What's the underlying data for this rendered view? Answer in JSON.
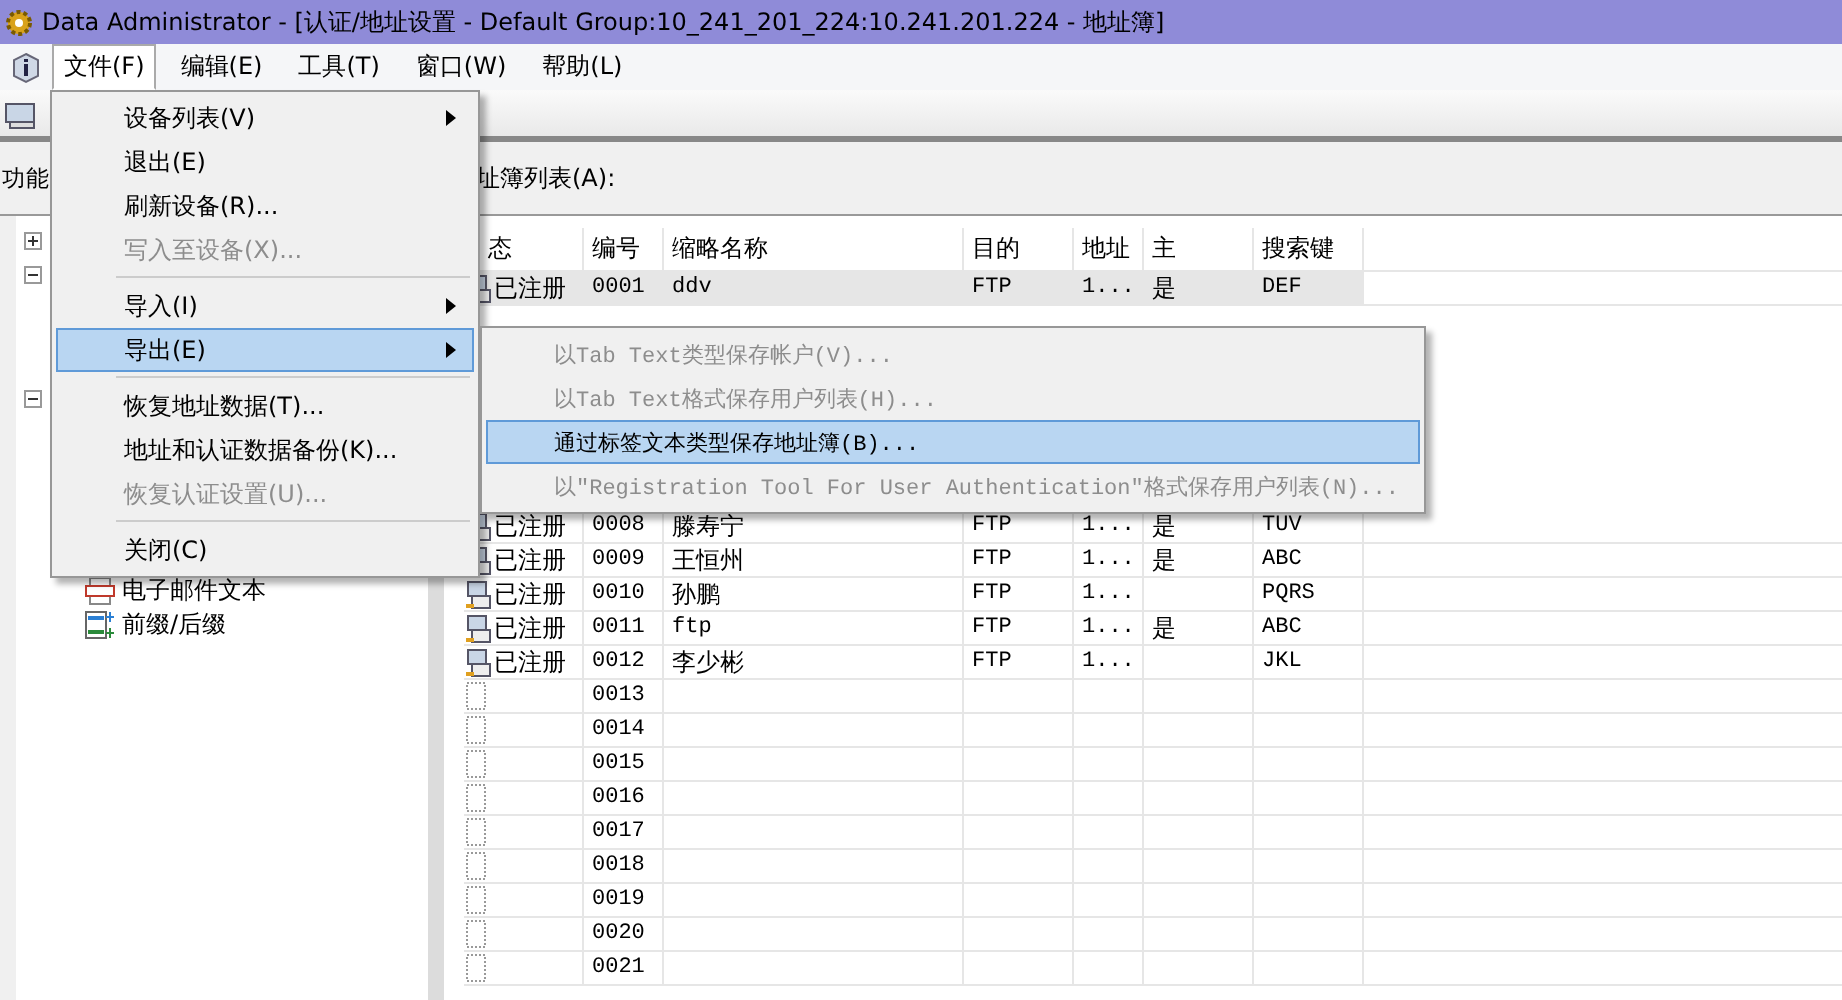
{
  "window": {
    "title": "Data Administrator - [认证/地址设置 - Default Group:10_241_201_224:10.241.201.224 - 地址簿]"
  },
  "menubar": [
    {
      "label": "文件(F)",
      "selected": true
    },
    {
      "label": "编辑(E)",
      "selected": false
    },
    {
      "label": "工具(T)",
      "selected": false
    },
    {
      "label": "窗口(W)",
      "selected": false
    },
    {
      "label": "帮助(L)",
      "selected": false
    }
  ],
  "file_menu": [
    {
      "kind": "item",
      "label": "设备列表(V)",
      "submenu": true,
      "disabled": false,
      "selected": false
    },
    {
      "kind": "item",
      "label": "退出(E)",
      "submenu": false,
      "disabled": false,
      "selected": false
    },
    {
      "kind": "item",
      "label": "刷新设备(R)...",
      "submenu": false,
      "disabled": false,
      "selected": false
    },
    {
      "kind": "item",
      "label": "写入至设备(X)...",
      "submenu": false,
      "disabled": true,
      "selected": false
    },
    {
      "kind": "separator"
    },
    {
      "kind": "item",
      "label": "导入(I)",
      "submenu": true,
      "disabled": false,
      "selected": false
    },
    {
      "kind": "item",
      "label": "导出(E)",
      "submenu": true,
      "disabled": false,
      "selected": true
    },
    {
      "kind": "separator"
    },
    {
      "kind": "item",
      "label": "恢复地址数据(T)...",
      "submenu": false,
      "disabled": false,
      "selected": false
    },
    {
      "kind": "item",
      "label": "地址和认证数据备份(K)...",
      "submenu": false,
      "disabled": false,
      "selected": false
    },
    {
      "kind": "item",
      "label": "恢复认证设置(U)...",
      "submenu": false,
      "disabled": true,
      "selected": false
    },
    {
      "kind": "separator"
    },
    {
      "kind": "item",
      "label": "关闭(C)",
      "submenu": false,
      "disabled": false,
      "selected": false
    }
  ],
  "export_submenu": [
    {
      "label": "以Tab Text类型保存帐户(V)...",
      "disabled": true,
      "selected": false
    },
    {
      "label": "以Tab Text格式保存用户列表(H)...",
      "disabled": true,
      "selected": false
    },
    {
      "label": "通过标签文本类型保存地址簿(B)...",
      "disabled": false,
      "selected": true
    },
    {
      "label": "以\"Registration Tool For User Authentication\"格式保存用户列表(N)...",
      "disabled": true,
      "selected": false
    }
  ],
  "left_panel": {
    "title": "功能",
    "tree": [
      {
        "expanded": false
      },
      {
        "expanded": true
      },
      {
        "expanded": true,
        "children": [
          {
            "label": "电子邮件文本",
            "kind": "email"
          },
          {
            "label": "前缀/后缀",
            "kind": "prefix"
          }
        ]
      }
    ]
  },
  "address_panel": {
    "title": "址簿列表(A):",
    "columns": [
      "态",
      "编号",
      "缩略名称",
      "目的",
      "地址",
      "主",
      "搜索键"
    ],
    "rows_top": [
      {
        "kind": "registered",
        "status": "已注册",
        "number": "0001",
        "name": "ddv",
        "purpose": "FTP",
        "address": "1...",
        "main": "是",
        "key": "DEF",
        "selected": true
      }
    ],
    "rows": [
      {
        "kind": "registered",
        "status": "已注册",
        "number": "0008",
        "name": "滕寿宁",
        "purpose": "FTP",
        "address": "1...",
        "main": "是",
        "key": "TUV",
        "selected": false
      },
      {
        "kind": "registered",
        "status": "已注册",
        "number": "0009",
        "name": "王恒州",
        "purpose": "FTP",
        "address": "1...",
        "main": "是",
        "key": "ABC",
        "selected": false
      },
      {
        "kind": "registered",
        "status": "已注册",
        "number": "0010",
        "name": "孙鹏",
        "purpose": "FTP",
        "address": "1...",
        "key": "PQRS",
        "selected": false
      },
      {
        "kind": "registered",
        "status": "已注册",
        "number": "0011",
        "name": "ftp",
        "purpose": "FTP",
        "address": "1...",
        "main": "是",
        "key": "ABC",
        "selected": false
      },
      {
        "kind": "registered",
        "status": "已注册",
        "number": "0012",
        "name": "李少彬",
        "purpose": "FTP",
        "address": "1...",
        "key": "JKL",
        "selected": false
      },
      {
        "kind": "empty",
        "number": "0013",
        "selected": false
      },
      {
        "kind": "empty",
        "number": "0014",
        "selected": false
      },
      {
        "kind": "empty",
        "number": "0015",
        "selected": false
      },
      {
        "kind": "empty",
        "number": "0016",
        "selected": false
      },
      {
        "kind": "empty",
        "number": "0017",
        "selected": false
      },
      {
        "kind": "empty",
        "number": "0018",
        "selected": false
      },
      {
        "kind": "empty",
        "number": "0019",
        "selected": false
      },
      {
        "kind": "empty",
        "number": "0020",
        "selected": false
      },
      {
        "kind": "empty",
        "number": "0021",
        "selected": false
      }
    ]
  }
}
